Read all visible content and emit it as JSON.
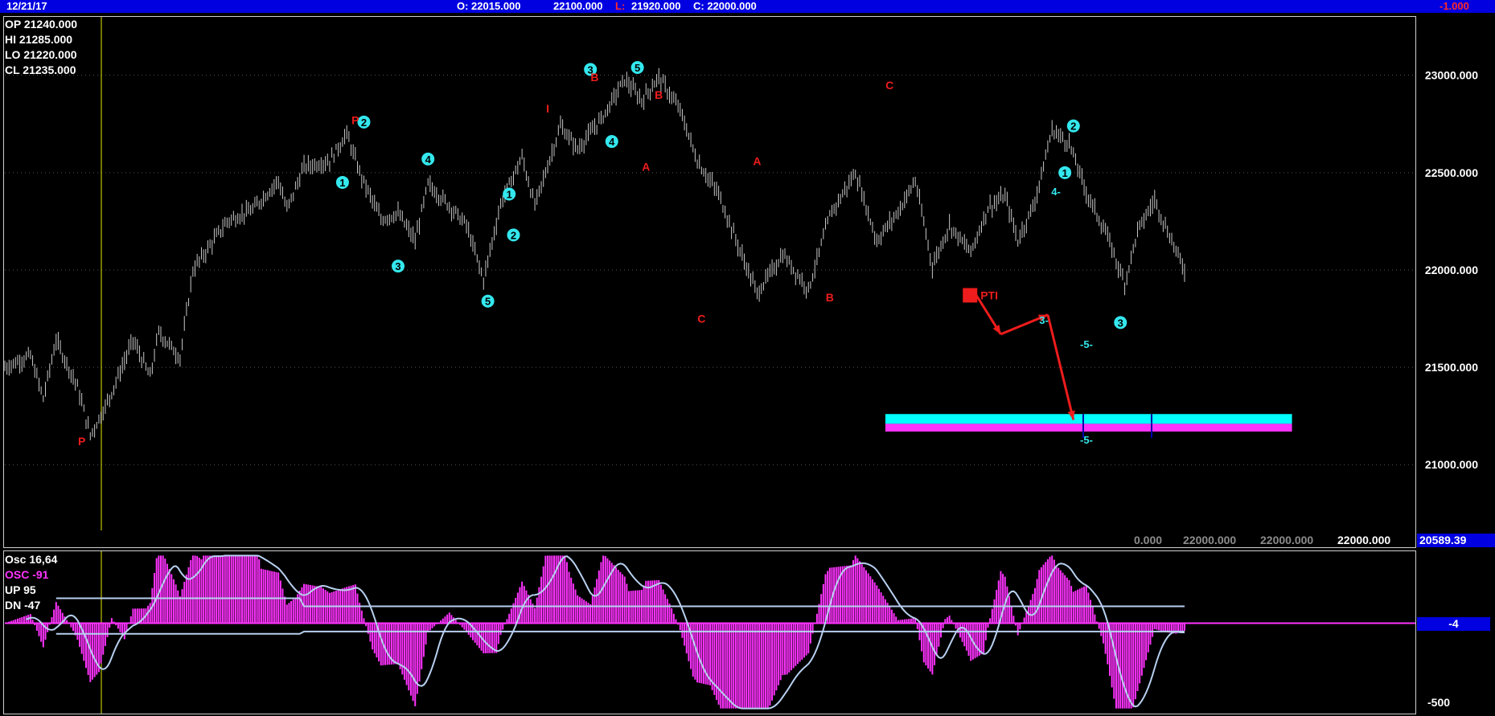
{
  "header": {
    "date": "12/21/17",
    "open": "O: 22015.000",
    "high": "22100.000",
    "low_prefix": "L:",
    "low": "21920.000",
    "close": "C: 22000.000",
    "change": "-1.000"
  },
  "ohlc_panel": {
    "op": "OP  21240.000",
    "hi": "HI   21285.000",
    "lo": "LO  21220.000",
    "cl": "CL  21235.000"
  },
  "bottom_values": {
    "v1": "0.000",
    "v2": "22000.000",
    "v3": "22000.000",
    "v4": "22000.000",
    "price_box": "20589.39"
  },
  "oscillator": {
    "osc_label": "Osc 16,64",
    "osc_value": "OSC -91",
    "up_label": "UP   95",
    "dn_label": "DN   -47",
    "zero_marker": "-4",
    "axis_bottom": "-500",
    "bands": {
      "upper_early": 140,
      "upper": 95,
      "lower": -47,
      "lower_early": -60
    },
    "hist_range": [
      -500,
      400
    ],
    "colors": {
      "histogram": "#ff33ff",
      "band": "#b8d0f0",
      "zero_line": "#e8e800"
    }
  },
  "colors": {
    "background": "#000000",
    "topbar": "#0000e0",
    "candles": "#c8c8c8",
    "cyan_labels": "#33e8ee",
    "red_labels": "#ee1c1c",
    "target_zone_upper": "#00ffff",
    "target_zone_lower": "#ff33ff"
  },
  "chart_data": {
    "type": "line",
    "description_series_name": "",
    "x_index_range": [
      0,
      300
    ],
    "ylim": [
      20580,
      23300
    ],
    "y_ticks": [
      "23000.000",
      "22500.000",
      "22000.000",
      "21500.000",
      "21000.000"
    ],
    "y_tick_values": [
      23000,
      22500,
      22000,
      21500,
      21000
    ],
    "price_path": [
      [
        0,
        21500
      ],
      [
        6,
        21560
      ],
      [
        9,
        21340
      ],
      [
        12,
        21640
      ],
      [
        17,
        21400
      ],
      [
        20,
        21150
      ],
      [
        24,
        21320
      ],
      [
        30,
        21640
      ],
      [
        34,
        21450
      ],
      [
        36,
        21680
      ],
      [
        41,
        21550
      ],
      [
        44,
        22000
      ],
      [
        52,
        22250
      ],
      [
        58,
        22310
      ],
      [
        64,
        22460
      ],
      [
        66,
        22310
      ],
      [
        70,
        22530
      ],
      [
        76,
        22560
      ],
      [
        80,
        22700
      ],
      [
        83,
        22500
      ],
      [
        88,
        22260
      ],
      [
        92,
        22290
      ],
      [
        96,
        22150
      ],
      [
        99,
        22440
      ],
      [
        104,
        22330
      ],
      [
        108,
        22230
      ],
      [
        112,
        21950
      ],
      [
        116,
        22340
      ],
      [
        121,
        22580
      ],
      [
        124,
        22330
      ],
      [
        130,
        22740
      ],
      [
        134,
        22620
      ],
      [
        140,
        22790
      ],
      [
        145,
        22980
      ],
      [
        149,
        22870
      ],
      [
        153,
        22990
      ],
      [
        158,
        22820
      ],
      [
        162,
        22560
      ],
      [
        167,
        22390
      ],
      [
        172,
        22100
      ],
      [
        176,
        21880
      ],
      [
        182,
        22080
      ],
      [
        188,
        21900
      ],
      [
        193,
        22280
      ],
      [
        199,
        22500
      ],
      [
        204,
        22150
      ],
      [
        209,
        22300
      ],
      [
        213,
        22460
      ],
      [
        217,
        22020
      ],
      [
        221,
        22230
      ],
      [
        226,
        22090
      ],
      [
        230,
        22320
      ],
      [
        234,
        22380
      ],
      [
        237,
        22150
      ],
      [
        241,
        22350
      ],
      [
        245,
        22720
      ],
      [
        249,
        22650
      ],
      [
        253,
        22400
      ],
      [
        258,
        22170
      ],
      [
        262,
        21930
      ],
      [
        265,
        22200
      ],
      [
        269,
        22360
      ],
      [
        272,
        22200
      ],
      [
        276,
        22000
      ]
    ],
    "wave_labels_cyan": [
      {
        "x": 79,
        "y": 22450,
        "t": "1"
      },
      {
        "x": 84,
        "y": 22760,
        "t": "2"
      },
      {
        "x": 92,
        "y": 22020,
        "t": "3"
      },
      {
        "x": 99,
        "y": 22570,
        "t": "4"
      },
      {
        "x": 113,
        "y": 21840,
        "t": "5"
      },
      {
        "x": 118,
        "y": 22390,
        "t": "1"
      },
      {
        "x": 119,
        "y": 22180,
        "t": "2"
      },
      {
        "x": 137,
        "y": 23030,
        "t": "3"
      },
      {
        "x": 142,
        "y": 22660,
        "t": "4"
      },
      {
        "x": 148,
        "y": 23040,
        "t": "5"
      },
      {
        "x": 248,
        "y": 22500,
        "t": "1"
      },
      {
        "x": 250,
        "y": 22740,
        "t": "2"
      },
      {
        "x": 261,
        "y": 21730,
        "t": "3"
      }
    ],
    "wave_labels_red": [
      {
        "x": 18,
        "y": 21120,
        "t": "P"
      },
      {
        "x": 82,
        "y": 22770,
        "t": "P"
      },
      {
        "x": 127,
        "y": 22830,
        "t": "I"
      },
      {
        "x": 138,
        "y": 22990,
        "t": "B"
      },
      {
        "x": 153,
        "y": 22900,
        "t": "B"
      },
      {
        "x": 150,
        "y": 22530,
        "t": "A"
      },
      {
        "x": 163,
        "y": 21750,
        "t": "C"
      },
      {
        "x": 176,
        "y": 22560,
        "t": "A"
      },
      {
        "x": 193,
        "y": 21860,
        "t": "B"
      },
      {
        "x": 207,
        "y": 22950,
        "t": "C"
      },
      {
        "x": 226,
        "y": 21870,
        "t": "PTI"
      }
    ],
    "projection_path": [
      [
        227,
        21880
      ],
      [
        233,
        21670
      ],
      [
        244,
        21770
      ],
      [
        250,
        21230
      ]
    ],
    "target_zone": {
      "x_start": 206,
      "x_end": 300,
      "upper": [
        21260,
        21210
      ],
      "lower": [
        21210,
        21170
      ]
    },
    "annotations": [
      "-5-",
      "-5-",
      "3-",
      "4-",
      "PTI"
    ]
  }
}
